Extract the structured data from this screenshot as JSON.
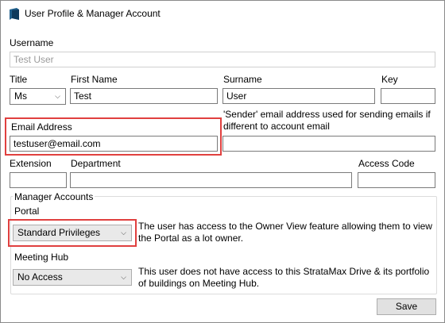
{
  "window": {
    "title": "User Profile & Manager Account",
    "icon": "app-icon"
  },
  "username": {
    "label": "Username",
    "value": "Test User"
  },
  "title_field": {
    "label": "Title",
    "value": "Ms"
  },
  "first_name": {
    "label": "First Name",
    "value": "Test"
  },
  "surname": {
    "label": "Surname",
    "value": "User"
  },
  "key": {
    "label": "Key",
    "value": ""
  },
  "email": {
    "label": "Email Address",
    "value": "testuser@email.com"
  },
  "sender_email": {
    "label": "'Sender' email address used for sending emails if different to account email",
    "value": ""
  },
  "extension": {
    "label": "Extension",
    "value": ""
  },
  "department": {
    "label": "Department",
    "value": ""
  },
  "access_code": {
    "label": "Access Code",
    "value": ""
  },
  "manager_accounts": {
    "group_label": "Manager Accounts",
    "portal": {
      "label": "Portal",
      "value": "Standard Privileges",
      "description": "The user has access to the Owner View feature allowing them to view the Portal as a lot owner."
    },
    "meeting_hub": {
      "label": "Meeting Hub",
      "value": "No Access",
      "description": "This user does not have access to this StrataMax Drive & its portfolio of buildings on Meeting Hub."
    }
  },
  "buttons": {
    "save": "Save"
  },
  "colors": {
    "highlight": "#e0403f",
    "icon": "#1f5f8b"
  }
}
